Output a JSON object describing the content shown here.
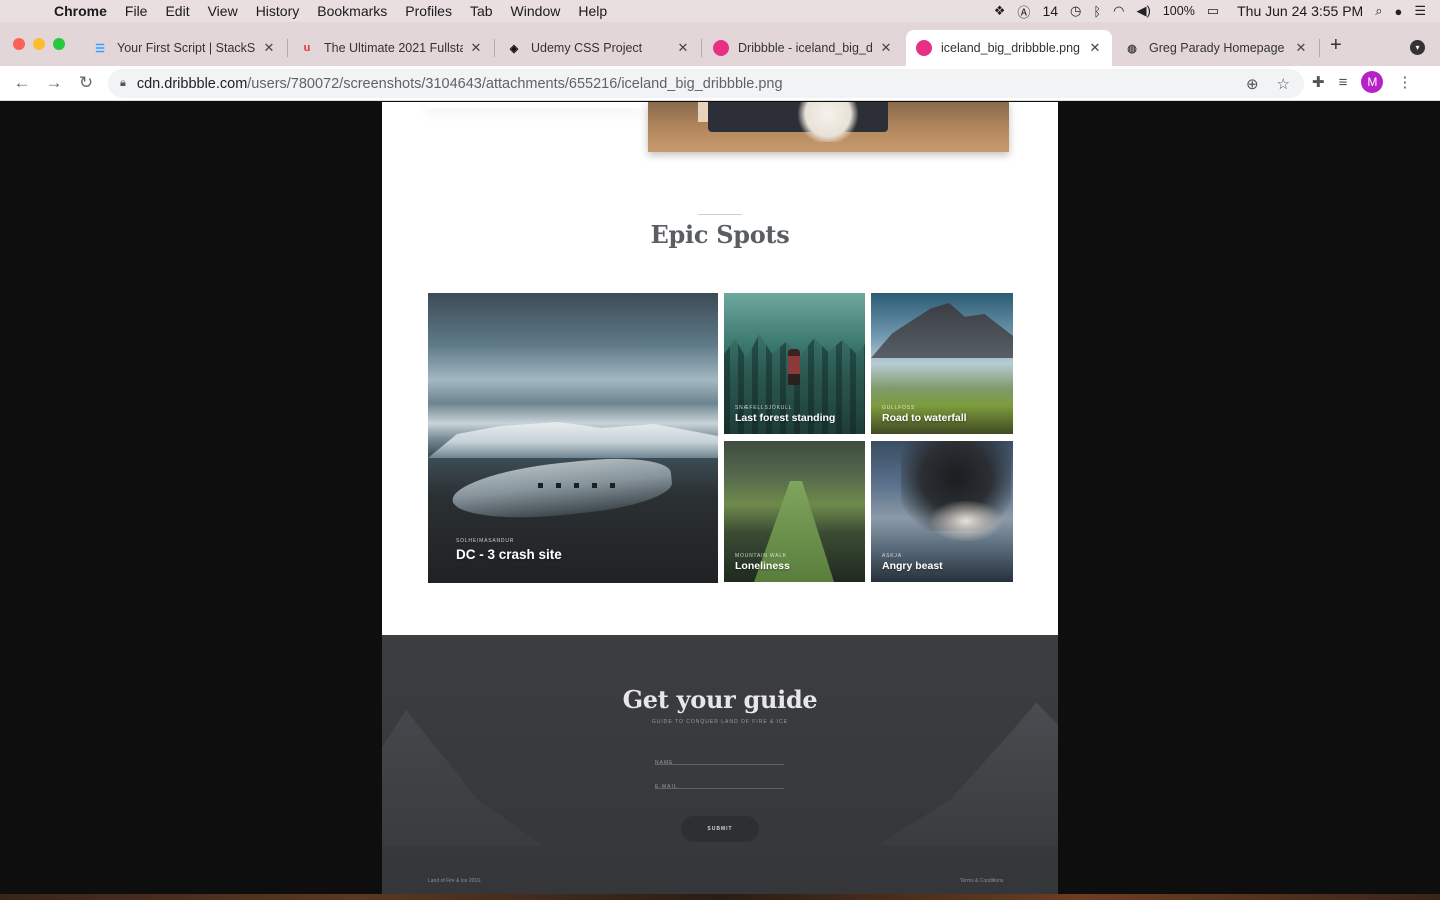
{
  "menubar": {
    "app": "Chrome",
    "items": [
      "File",
      "Edit",
      "View",
      "History",
      "Bookmarks",
      "Profiles",
      "Tab",
      "Window",
      "Help"
    ],
    "notif_count": "14",
    "battery": "100%",
    "clock": "Thu Jun 24  3:55 PM"
  },
  "tabs": [
    {
      "title": "Your First Script | StackSk",
      "favicon": "stackskills-icon",
      "color": "#35a0ff"
    },
    {
      "title": "The Ultimate 2021 Fullsta",
      "favicon": "udemy-icon",
      "color": "#e8303a"
    },
    {
      "title": "Udemy CSS Project",
      "favicon": "codepen-icon",
      "color": "#111111"
    },
    {
      "title": "Dribbble - iceland_big_dr",
      "favicon": "dribbble-icon",
      "color": "#ea2f86"
    },
    {
      "title": "iceland_big_dribbble.png",
      "favicon": "dribbble-icon",
      "color": "#ea2f86"
    },
    {
      "title": "Greg Parady Homepage",
      "favicon": "globe-icon",
      "color": "#444444"
    }
  ],
  "toolbar": {
    "url_host": "cdn.dribbble.com",
    "url_path": "/users/780072/screenshots/3104643/attachments/655216/iceland_big_dribbble.png",
    "avatar_initial": "M"
  },
  "page": {
    "section_title": "Epic Spots",
    "spots": [
      {
        "location": "SOLHEIMASANDUR",
        "name": "DC - 3 crash site"
      },
      {
        "location": "SNÆFELLSJÖKULL",
        "name": "Last forest standing"
      },
      {
        "location": "GULLFOSS",
        "name": "Road to waterfall"
      },
      {
        "location": "MOUNTAIN WALK",
        "name": "Loneliness"
      },
      {
        "location": "ASKJA",
        "name": "Angry beast"
      }
    ],
    "guide": {
      "title": "Get your guide",
      "subtitle": "GUIDE TO CONQUER LAND OF FIRE & ICE",
      "name_placeholder": "NAME",
      "email_placeholder": "E-MAIL",
      "submit_label": "SUBMIT"
    },
    "footer_left": "Land of Fire & Ice 2016.",
    "footer_right": "Terms & Conditions"
  },
  "colors": {
    "menubar_bg": "#e9dfe1",
    "tabstrip_bg": "#e3d6d9",
    "footer_bg": "#3a3c3f",
    "title_text": "#5a5e63"
  }
}
